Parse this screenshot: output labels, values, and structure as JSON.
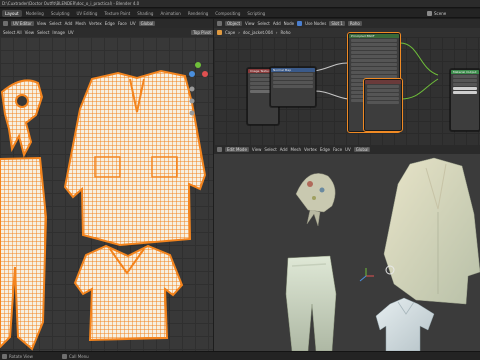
{
  "window": {
    "title": "D:\\Cuxtrader\\Doctor Outfit\\BLENDER\\doc_o_i_practical\\ - Blender 4.0"
  },
  "workspace_tabs": [
    "Layout",
    "Modeling",
    "Sculpting",
    "UV Editing",
    "Texture Paint",
    "Shading",
    "Animation",
    "Rendering",
    "Compositing",
    "Scripting"
  ],
  "active_workspace": "Layout",
  "scene": {
    "label": "Scene"
  },
  "uv_editor": {
    "header": [
      "Select All",
      "View",
      "Select",
      "Image",
      "UV"
    ],
    "mode_label": "UV Editor",
    "menus": [
      "View",
      "Select",
      "Add",
      "Mesh",
      "Vertex",
      "Edge",
      "Face",
      "UV"
    ],
    "sync_label": "Global",
    "snap_label": "Top Pivot"
  },
  "node_editor": {
    "menus": [
      "Object",
      "View",
      "Select",
      "Add",
      "Node"
    ],
    "use_nodes_label": "Use Nodes",
    "slot_label": "Slot 1",
    "material_label": "Roho",
    "breadcrumb": [
      "Cape",
      "doc_jacket.004",
      "Roho"
    ],
    "node_titles": {
      "image": "Image Texture",
      "mix": "Normal Map",
      "bsdf": "Principled BSDF",
      "out": "Material Output"
    }
  },
  "viewport_3d": {
    "mode_label": "Edit Mode",
    "menus": [
      "View",
      "Select",
      "Add",
      "Mesh",
      "Vertex",
      "Edge",
      "Face",
      "UV"
    ],
    "transform_label": "Global"
  },
  "statusbar": {
    "left": "Rotate View",
    "mid": "Call Menu"
  },
  "colors": {
    "accent": "#f08a24",
    "uv_mesh": "#f3841e"
  }
}
